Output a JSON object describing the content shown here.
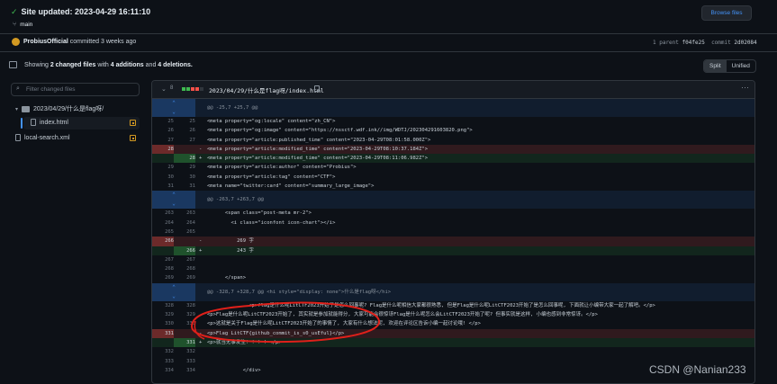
{
  "header": {
    "title": "Site updated: 2023-04-29 16:11:10",
    "branch": "main",
    "browse_button": "Browse files"
  },
  "commit": {
    "author": "ProbiusOfficial",
    "when": "committed 3 weeks ago",
    "parent_label": "1 parent",
    "parent_sha": "f04fe25",
    "commit_label": "commit",
    "commit_sha": "2d02084"
  },
  "summary": {
    "prefix": "Showing",
    "files": "2 changed files",
    "mid": "with",
    "additions": "4 additions",
    "and": "and",
    "deletions": "4 deletions.",
    "split": "Split",
    "unified": "Unified"
  },
  "sidebar": {
    "filter_placeholder": "Filter changed files",
    "folder": "2023/04/29/什么是flag呀/",
    "file_index": "index.html",
    "file_search": "local-search.xml"
  },
  "diff": {
    "changes": "8",
    "path": "2023/04/29/什么是flag呀/index.html",
    "rows": [
      {
        "t": "hunk",
        "code": "@@ -25,7 +25,7 @@"
      },
      {
        "t": "ctx",
        "a": "25",
        "b": "25",
        "code": "<meta property=\"og:locale\" content=\"zh_CN\">"
      },
      {
        "t": "ctx",
        "a": "26",
        "b": "26",
        "code": "<meta property=\"og:image\" content=\"https://nssctf.wdf.ink//img/WDTJ/202304291603820.png\">"
      },
      {
        "t": "ctx",
        "a": "27",
        "b": "27",
        "code": "<meta property=\"article:published_time\" content=\"2023-04-29T08:01:58.000Z\">"
      },
      {
        "t": "del",
        "a": "28",
        "b": "",
        "code": "<meta property=\"article:modified_time\" content=\"2023-04-29T08:10:37.184Z\">"
      },
      {
        "t": "add",
        "a": "",
        "b": "28",
        "code": "<meta property=\"article:modified_time\" content=\"2023-04-29T08:11:06.982Z\">"
      },
      {
        "t": "ctx",
        "a": "29",
        "b": "29",
        "code": "<meta property=\"article:author\" content=\"Probius\">"
      },
      {
        "t": "ctx",
        "a": "30",
        "b": "30",
        "code": "<meta property=\"article:tag\" content=\"CTF\">"
      },
      {
        "t": "ctx",
        "a": "31",
        "b": "31",
        "code": "<meta name=\"twitter:card\" content=\"summary_large_image\">"
      },
      {
        "t": "hunk",
        "code": "@@ -263,7 +263,7 @@"
      },
      {
        "t": "ctx",
        "a": "263",
        "b": "263",
        "code": "      <span class=\"post-meta mr-2\">"
      },
      {
        "t": "ctx",
        "a": "264",
        "b": "264",
        "code": "        <i class=\"iconfont icon-chart\"></i>"
      },
      {
        "t": "ctx",
        "a": "265",
        "b": "265",
        "code": ""
      },
      {
        "t": "del",
        "a": "266",
        "b": "",
        "code": "          269 字"
      },
      {
        "t": "add",
        "a": "",
        "b": "266",
        "code": "          243 字"
      },
      {
        "t": "ctx",
        "a": "267",
        "b": "267",
        "code": ""
      },
      {
        "t": "ctx",
        "a": "268",
        "b": "268",
        "code": ""
      },
      {
        "t": "ctx",
        "a": "269",
        "b": "269",
        "code": "      </span>"
      },
      {
        "t": "hunk",
        "code": "@@ -328,7 +328,7 @@ <hi style=\"display: none\">什么是flag呀</hi>"
      },
      {
        "t": "ctx",
        "a": "328",
        "b": "328",
        "code": "              <p>flag是什么呢LitCTF2023开始了是怎么回事呢? Flag是什么呢相信大家都很熟悉, 但是Flag是什么呢LitCTF2023开始了是怎么回事呢, 下面就让小编带大家一起了解吧。</p>"
      },
      {
        "t": "ctx",
        "a": "329",
        "b": "329",
        "code": "<p>Flag是什么呢LitCTF2023开始了, 其实就是参加就能得分, 大家可能会很惊讶Flag是什么呢怎么会LitCTF2023开始了呢? 但事实就是这样, 小编也感到非常惊讶。</p>"
      },
      {
        "t": "ctx",
        "a": "330",
        "b": "330",
        "code": "<p>这就是关于Flag是什么呢LitCTF2023开始了的事情了, 大家有什么想法呢, 欢迎在评论区告诉小编一起讨论哦! </p>"
      },
      {
        "t": "del",
        "a": "331",
        "b": "",
        "code": "<p>Flag LitCTF{github_commit_is_s0_usEful}</p>"
      },
      {
        "t": "add",
        "a": "",
        "b": "331",
        "code": "<p>就当无事发生! ! ! ! </p>"
      },
      {
        "t": "ctx",
        "a": "332",
        "b": "332",
        "code": ""
      },
      {
        "t": "ctx",
        "a": "333",
        "b": "333",
        "code": ""
      },
      {
        "t": "ctx",
        "a": "334",
        "b": "334",
        "code": "            </div>"
      }
    ]
  },
  "watermark": "CSDN @Nanian233",
  "colors": {
    "accent": "#4493f8",
    "added": "#3fb950",
    "deleted": "#f85149",
    "modified": "#d29922",
    "annotation": "#e0201a"
  }
}
